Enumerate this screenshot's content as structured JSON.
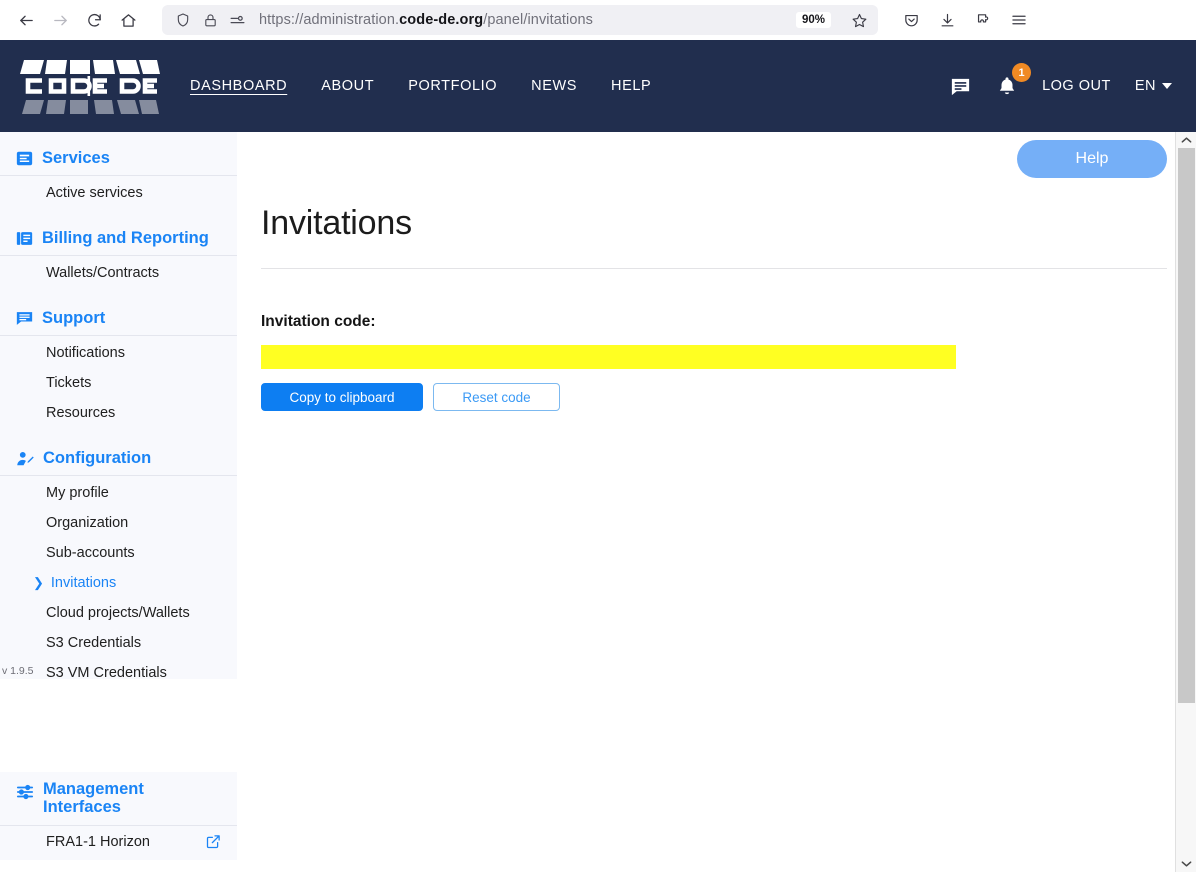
{
  "browser": {
    "back_icon": "back-arrow-icon",
    "forward_icon": "forward-arrow-icon",
    "reload_icon": "reload-icon",
    "home_icon": "home-icon",
    "shield_icon": "shield-icon",
    "lock_icon": "padlock-icon",
    "permissions_icon": "site-permissions-icon",
    "url_prefix": "https://administration.",
    "url_domain": "code-de.org",
    "url_path": "/panel/invitations",
    "zoom_level": "90%",
    "bookmark_icon": "star-icon",
    "pocket_icon": "pocket-icon",
    "downloads_icon": "downloads-icon",
    "extensions_icon": "extensions-icon",
    "menu_icon": "hamburger-menu-icon"
  },
  "header": {
    "logo_text": "CODE|DE",
    "nav": [
      {
        "label": "DASHBOARD",
        "active": true
      },
      {
        "label": "ABOUT",
        "active": false
      },
      {
        "label": "PORTFOLIO",
        "active": false
      },
      {
        "label": "NEWS",
        "active": false
      },
      {
        "label": "HELP",
        "active": false
      }
    ],
    "messages_icon": "message-icon",
    "notifications_icon": "bell-icon",
    "notifications_count": "1",
    "logout_label": "LOG OUT",
    "language": "EN",
    "bg_color": "#212e4e",
    "badge_color": "#f08a24"
  },
  "sidebar": {
    "accent_color": "#1a84f5",
    "bg_color": "#f8f9fd",
    "sections": [
      {
        "title": "Services",
        "icon": "services-icon",
        "items": [
          {
            "label": "Active services",
            "active": false
          }
        ]
      },
      {
        "title": "Billing and Reporting",
        "icon": "billing-icon",
        "items": [
          {
            "label": "Wallets/Contracts",
            "active": false
          }
        ]
      },
      {
        "title": "Support",
        "icon": "support-icon",
        "items": [
          {
            "label": "Notifications",
            "active": false
          },
          {
            "label": "Tickets",
            "active": false
          },
          {
            "label": "Resources",
            "active": false
          }
        ]
      },
      {
        "title": "Configuration",
        "icon": "user-config-icon",
        "items": [
          {
            "label": "My profile",
            "active": false
          },
          {
            "label": "Organization",
            "active": false
          },
          {
            "label": "Sub-accounts",
            "active": false
          },
          {
            "label": "Invitations",
            "active": true
          },
          {
            "label": "Cloud projects/Wallets",
            "active": false
          },
          {
            "label": "S3 Credentials",
            "active": false
          },
          {
            "label": "S3 VM Credentials",
            "active": false
          }
        ]
      }
    ],
    "management": {
      "title": "Management Interfaces",
      "icon": "sliders-icon",
      "items": [
        {
          "label": "FRA1-1 Horizon",
          "external_icon": "external-link-icon"
        }
      ]
    },
    "version": "v 1.9.5"
  },
  "main": {
    "help_button": "Help",
    "help_color": "#75aff7",
    "title": "Invitations",
    "invitation_code_label": "Invitation code:",
    "invitation_code_value": "",
    "invitation_code_highlight": "#ffff22",
    "copy_button": "Copy to clipboard",
    "reset_button": "Reset code",
    "primary_color": "#0d7ef2"
  },
  "scrollbar": {
    "up_arrow": "chevron-up-icon",
    "down_arrow": "chevron-down-icon"
  }
}
